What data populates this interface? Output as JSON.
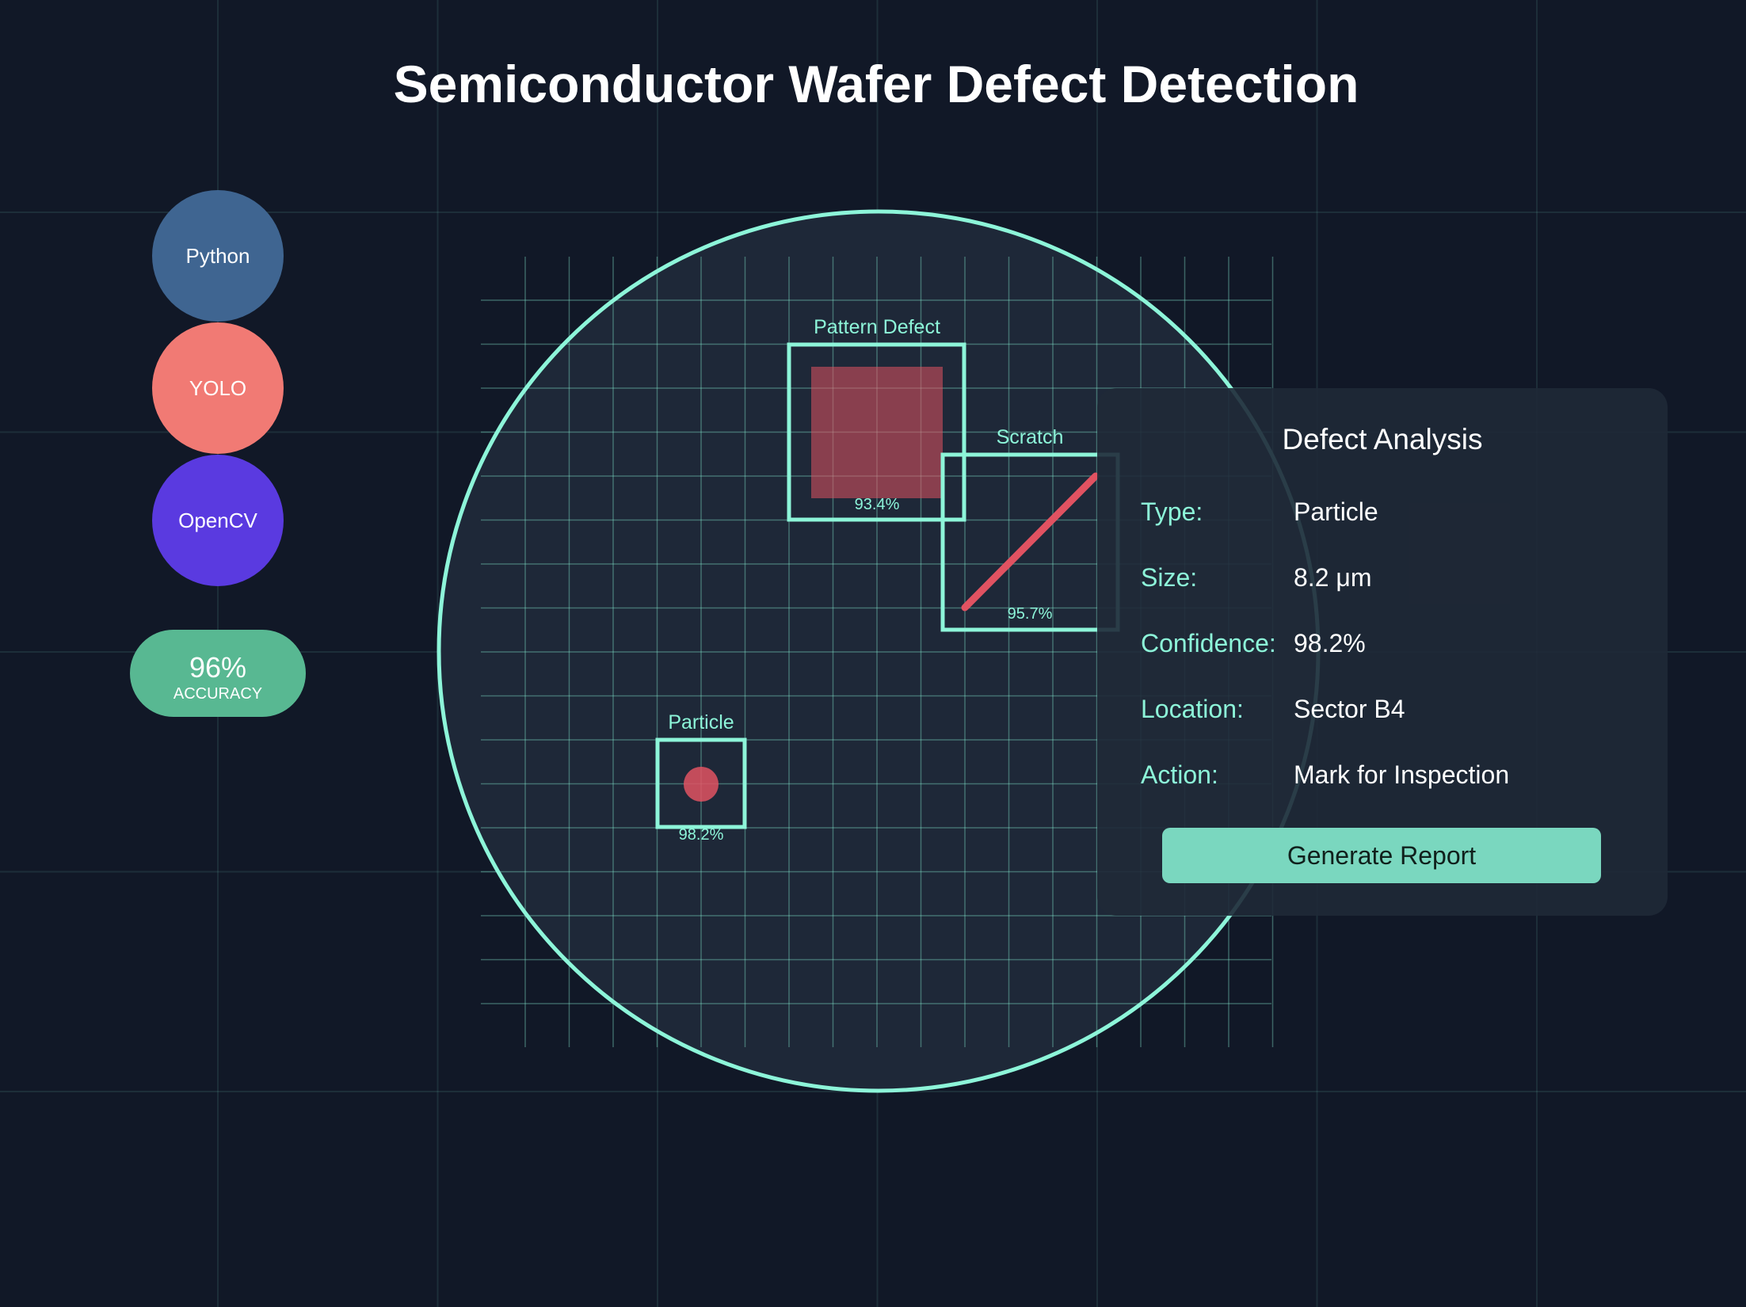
{
  "title": "Semiconductor Wafer Defect Detection",
  "tech_stack": [
    {
      "label": "Python",
      "color": "#3f6591"
    },
    {
      "label": "YOLO",
      "color": "#f17a74"
    },
    {
      "label": "OpenCV",
      "color": "#5a3ae0"
    }
  ],
  "accuracy": {
    "value": "96%",
    "label": "ACCURACY",
    "color": "#58b892"
  },
  "wafer": {
    "outline_color": "#8df5d9",
    "fill_color": "#1e2838",
    "defect_color": "#e15261",
    "detections": [
      {
        "label": "Pattern Defect",
        "confidence": "93.4%",
        "kind": "pattern"
      },
      {
        "label": "Scratch",
        "confidence": "95.7%",
        "kind": "scratch"
      },
      {
        "label": "Particle",
        "confidence": "98.2%",
        "kind": "particle"
      }
    ]
  },
  "panel": {
    "title": "Defect Analysis",
    "rows": [
      {
        "key": "Type:",
        "value": "Particle"
      },
      {
        "key": "Size:",
        "value": "8.2 μm"
      },
      {
        "key": "Confidence:",
        "value": "98.2%"
      },
      {
        "key": "Location:",
        "value": "Sector B4"
      },
      {
        "key": "Action:",
        "value": "Mark for Inspection"
      }
    ],
    "button_label": "Generate Report"
  }
}
